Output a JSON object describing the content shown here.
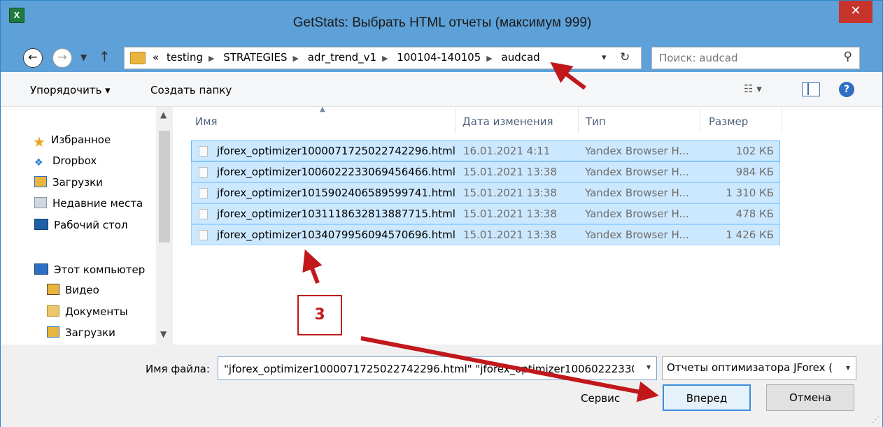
{
  "window": {
    "title": "GetStats: Выбрать HTML отчеты (максимум 999)",
    "app_icon_glyph": "X",
    "close_glyph": "✕"
  },
  "address_bar": {
    "overflow": "«",
    "crumbs": [
      "testing",
      "STRATEGIES",
      "adr_trend_v1",
      "100104-140105",
      "audcad"
    ],
    "search_placeholder": "Поиск: audcad"
  },
  "toolbar": {
    "organize_label": "Упорядочить ▾",
    "new_folder_label": "Создать папку"
  },
  "nav_pane": {
    "favorites_header": "Избранное",
    "favorites": [
      "Dropbox",
      "Загрузки",
      "Недавние места",
      "Рабочий стол"
    ],
    "computer_header": "Этот компьютер",
    "computer": [
      "Видео",
      "Документы",
      "Загрузки"
    ]
  },
  "columns": {
    "name": "Имя",
    "date": "Дата изменения",
    "type": "Тип",
    "size": "Размер"
  },
  "files": [
    {
      "name": "jforex_optimizer1000071725022742296.html",
      "date": "16.01.2021 4:11",
      "type": "Yandex Browser H...",
      "size": "102 КБ"
    },
    {
      "name": "jforex_optimizer1006022233069456466.html",
      "date": "15.01.2021 13:38",
      "type": "Yandex Browser H...",
      "size": "984 КБ"
    },
    {
      "name": "jforex_optimizer1015902406589599741.html",
      "date": "15.01.2021 13:38",
      "type": "Yandex Browser H...",
      "size": "1 310 КБ"
    },
    {
      "name": "jforex_optimizer1031118632813887715.html",
      "date": "15.01.2021 13:38",
      "type": "Yandex Browser H...",
      "size": "478 КБ"
    },
    {
      "name": "jforex_optimizer1034079956094570696.html",
      "date": "15.01.2021 13:38",
      "type": "Yandex Browser H...",
      "size": "1 426 КБ"
    }
  ],
  "bottom": {
    "filename_label": "Имя файла:",
    "filename_value": "\"jforex_optimizer1000071725022742296.html\" \"jforex_optimizer10060222330(",
    "filter_value": "Отчеты оптимизатора JForex (",
    "service_label": "Сервис",
    "ok_label": "Вперед",
    "cancel_label": "Отмена"
  },
  "annotation": {
    "step_label": "3",
    "color": "#c0181b"
  }
}
